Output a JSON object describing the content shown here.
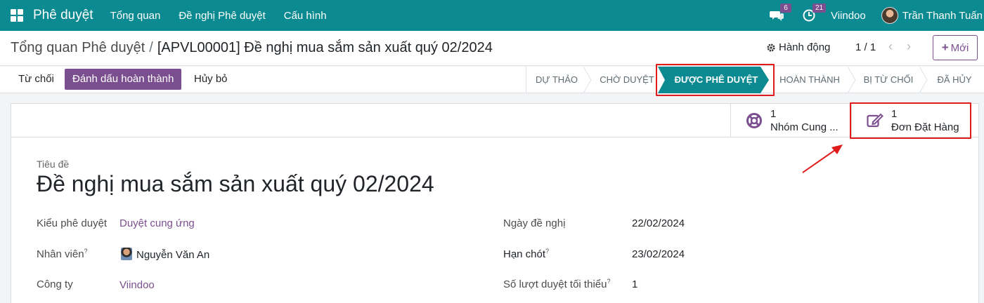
{
  "navbar": {
    "app_name": "Phê duyệt",
    "menus": [
      "Tổng quan",
      "Đề nghị Phê duyệt",
      "Cấu hình"
    ],
    "messages_badge": "6",
    "activities_badge": "21",
    "company": "Viindoo",
    "user": "Trần Thanh Tuấn"
  },
  "control": {
    "breadcrumb_parent": "Tổng quan Phê duyệt",
    "breadcrumb_sep": "/",
    "breadcrumb_current": "[APVL00001] Đề nghị mua sắm sản xuất quý 02/2024",
    "actions_label": "Hành động",
    "pager": "1 / 1",
    "new_label": "Mới"
  },
  "statusbar": {
    "buttons": [
      "Từ chối",
      "Đánh dấu hoàn thành",
      "Hủy bỏ"
    ],
    "stages": [
      "DỰ THẢO",
      "CHỜ DUYỆT",
      "ĐƯỢC PHÊ DUYỆT",
      "HOÀN THÀNH",
      "BỊ TỪ CHỐI",
      "ĐÃ HỦY"
    ],
    "active_stage": "ĐƯỢC PHÊ DUYỆT"
  },
  "smart_buttons": [
    {
      "value": "1",
      "label": "Nhóm Cung ...",
      "icon": "life-ring-icon"
    },
    {
      "value": "1",
      "label": "Đơn Đặt Hàng",
      "icon": "edit-icon"
    }
  ],
  "form": {
    "title_label": "Tiêu đề",
    "title": "Đề nghị mua sắm sản xuất quý 02/2024",
    "approval_type_label": "Kiểu phê duyệt",
    "approval_type": "Duyệt cung ứng",
    "employee_label": "Nhân viên",
    "employee": "Nguyễn Văn An",
    "company_label": "Công ty",
    "company": "Viindoo",
    "request_date_label": "Ngày đề nghị",
    "request_date": "22/02/2024",
    "deadline_label": "Hạn chót",
    "deadline": "23/02/2024",
    "min_approvals_label": "Số lượt duyệt tối thiểu",
    "min_approvals": "1",
    "help_mark": "?"
  },
  "colors": {
    "navbar": "#0b8a91",
    "primary": "#7b4f8f",
    "active_stage": "#0b8a91",
    "highlight": "#e01b1b"
  }
}
